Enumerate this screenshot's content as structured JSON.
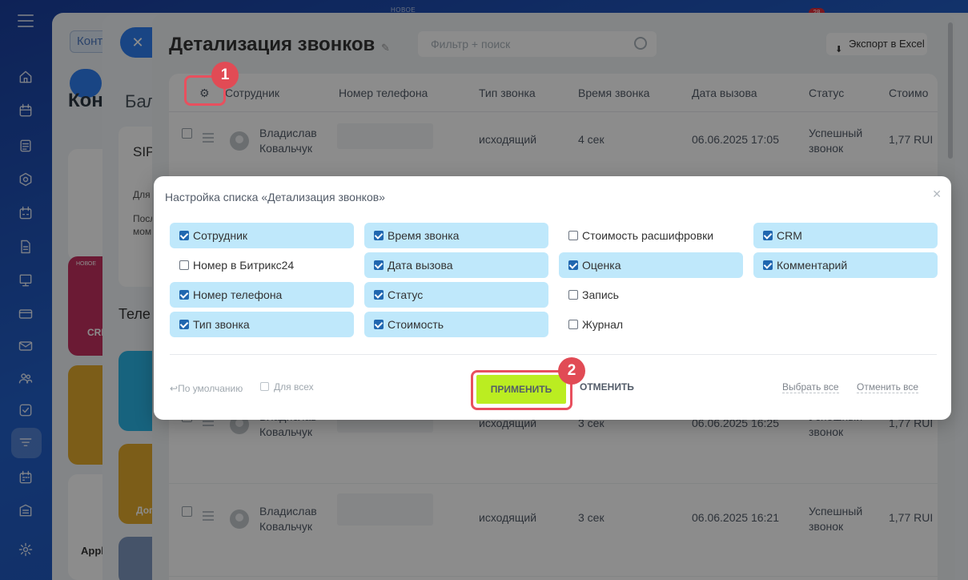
{
  "top_badge_new": "НОВОЕ",
  "top_badge_count": "28",
  "panel1": {
    "tab_label": "Конт",
    "heading": "Кон",
    "card_new_badge": "НОВОЕ",
    "card_crm": "CRI",
    "card_apple": "Appl"
  },
  "panel2": {
    "heading": "Бал",
    "sip_title": "SIP",
    "line1": "Для",
    "line2": "Посл",
    "line3": "мом",
    "tele": "Теле",
    "card_do": "Доп"
  },
  "main": {
    "title": "Детализация звонков",
    "search_placeholder": "Фильтр + поиск",
    "export_label": "Экспорт в Excel",
    "columns": [
      "Сотрудник",
      "Номер телефона",
      "Тип звонка",
      "Время звонка",
      "Дата вызова",
      "Статус",
      "Стоимо"
    ],
    "rows": [
      {
        "name1": "Владислав",
        "name2": "Ковальчук",
        "type": "исходящий",
        "duration": "4 сек",
        "date": "06.06.2025 17:05",
        "status1": "Успешный",
        "status2": "звонок",
        "cost": "1,77 RUI"
      },
      {
        "name1": "Владислав",
        "name2": "Ковальчук",
        "type": "исходящий",
        "duration": "3 сек",
        "date": "06.06.2025 16:25",
        "status1": "Успешный",
        "status2": "звонок",
        "cost": "1,77 RUI"
      },
      {
        "name1": "Владислав",
        "name2": "Ковальчук",
        "type": "исходящий",
        "duration": "3 сек",
        "date": "06.06.2025 16:21",
        "status1": "Успешный",
        "status2": "звонок",
        "cost": "1,77 RUI"
      }
    ]
  },
  "popup": {
    "title": "Настройка списка «Детализация звонков»",
    "options": [
      {
        "label": "Сотрудник",
        "checked": true
      },
      {
        "label": "Номер в Битрикс24",
        "checked": false
      },
      {
        "label": "Номер телефона",
        "checked": true
      },
      {
        "label": "Тип звонка",
        "checked": true
      },
      {
        "label": "Время звонка",
        "checked": true
      },
      {
        "label": "Дата вызова",
        "checked": true
      },
      {
        "label": "Статус",
        "checked": true
      },
      {
        "label": "Стоимость",
        "checked": true
      },
      {
        "label": "Стоимость расшифровки",
        "checked": false
      },
      {
        "label": "Оценка",
        "checked": true
      },
      {
        "label": "Запись",
        "checked": false
      },
      {
        "label": "Журнал",
        "checked": false
      },
      {
        "label": "CRM",
        "checked": true
      },
      {
        "label": "Комментарий",
        "checked": true
      }
    ],
    "default_link": "По умолчанию",
    "for_all": "Для всех",
    "apply": "ПРИМЕНИТЬ",
    "cancel": "ОТМЕНИТЬ",
    "select_all": "Выбрать все",
    "deselect_all": "Отменить все"
  },
  "callouts": {
    "step1": "1",
    "step2": "2"
  },
  "colors": {
    "accent_blue": "#2f7ff0",
    "apply_green": "#bbed21",
    "highlight_red": "#e8505e",
    "option_bg": "#bfe8fb"
  }
}
